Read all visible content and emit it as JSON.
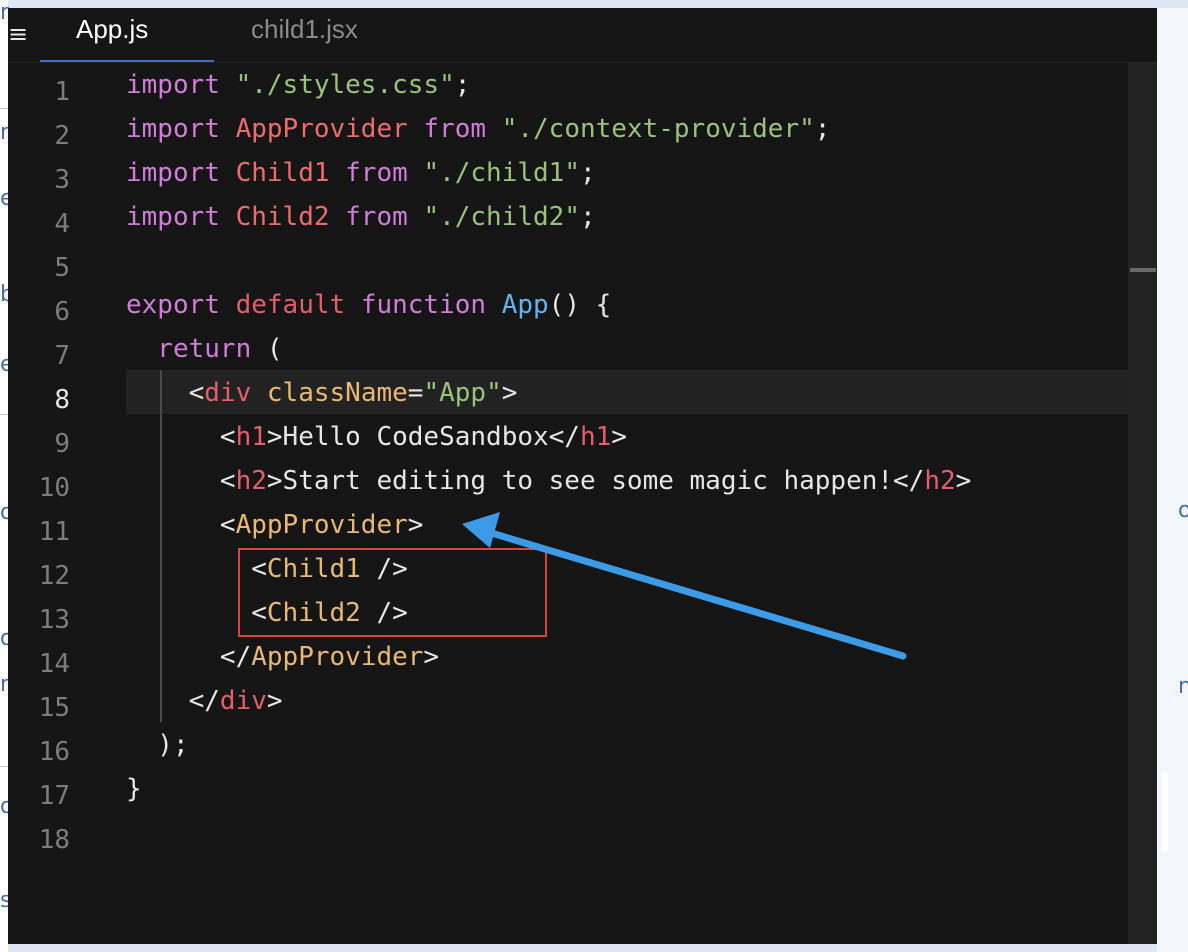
{
  "editor": {
    "menu_icon": "≡",
    "tabs": [
      {
        "label": "App.js",
        "active": true
      },
      {
        "label": "child1.jsx",
        "active": false
      }
    ],
    "active_line": 8,
    "line_numbers": [
      "1",
      "2",
      "3",
      "4",
      "5",
      "6",
      "7",
      "8",
      "9",
      "10",
      "11",
      "12",
      "13",
      "14",
      "15",
      "16",
      "17",
      "18"
    ]
  },
  "code_lines": [
    [
      {
        "t": "import ",
        "c": "kw"
      },
      {
        "t": "\"./styles.css\"",
        "c": "str"
      },
      {
        "t": ";",
        "c": "punc"
      }
    ],
    [
      {
        "t": "import ",
        "c": "kw"
      },
      {
        "t": "AppProvider ",
        "c": "cls"
      },
      {
        "t": "from ",
        "c": "kw"
      },
      {
        "t": "\"./context-provider\"",
        "c": "str"
      },
      {
        "t": ";",
        "c": "punc"
      }
    ],
    [
      {
        "t": "import ",
        "c": "kw"
      },
      {
        "t": "Child1 ",
        "c": "cls"
      },
      {
        "t": "from ",
        "c": "kw"
      },
      {
        "t": "\"./child1\"",
        "c": "str"
      },
      {
        "t": ";",
        "c": "punc"
      }
    ],
    [
      {
        "t": "import ",
        "c": "kw"
      },
      {
        "t": "Child2 ",
        "c": "cls"
      },
      {
        "t": "from ",
        "c": "kw"
      },
      {
        "t": "\"./child2\"",
        "c": "str"
      },
      {
        "t": ";",
        "c": "punc"
      }
    ],
    [],
    [
      {
        "t": "export ",
        "c": "kw"
      },
      {
        "t": "default ",
        "c": "tag"
      },
      {
        "t": "function ",
        "c": "kw"
      },
      {
        "t": "App",
        "c": "fn"
      },
      {
        "t": "() {",
        "c": "punc"
      }
    ],
    [
      {
        "t": "  return ",
        "c": "kw"
      },
      {
        "t": "(",
        "c": "punc"
      }
    ],
    [
      {
        "t": "    <",
        "c": "punc"
      },
      {
        "t": "div ",
        "c": "tag"
      },
      {
        "t": "className",
        "c": "attr"
      },
      {
        "t": "=",
        "c": "punc"
      },
      {
        "t": "\"App\"",
        "c": "str"
      },
      {
        "t": ">",
        "c": "punc"
      }
    ],
    [
      {
        "t": "      <",
        "c": "punc"
      },
      {
        "t": "h1",
        "c": "tag"
      },
      {
        "t": ">Hello CodeSandbox</",
        "c": "punc"
      },
      {
        "t": "h1",
        "c": "tag"
      },
      {
        "t": ">",
        "c": "punc"
      }
    ],
    [
      {
        "t": "      <",
        "c": "punc"
      },
      {
        "t": "h2",
        "c": "tag"
      },
      {
        "t": ">Start editing to see some magic happen!</",
        "c": "punc"
      },
      {
        "t": "h2",
        "c": "tag"
      },
      {
        "t": ">",
        "c": "punc"
      }
    ],
    [
      {
        "t": "      <",
        "c": "punc"
      },
      {
        "t": "AppProvider",
        "c": "comp"
      },
      {
        "t": ">",
        "c": "punc"
      }
    ],
    [
      {
        "t": "        <",
        "c": "punc"
      },
      {
        "t": "Child1 ",
        "c": "comp"
      },
      {
        "t": "/>",
        "c": "punc"
      }
    ],
    [
      {
        "t": "        <",
        "c": "punc"
      },
      {
        "t": "Child2 ",
        "c": "comp"
      },
      {
        "t": "/>",
        "c": "punc"
      }
    ],
    [
      {
        "t": "      </",
        "c": "punc"
      },
      {
        "t": "AppProvider",
        "c": "comp"
      },
      {
        "t": ">",
        "c": "punc"
      }
    ],
    [
      {
        "t": "    </",
        "c": "punc"
      },
      {
        "t": "div",
        "c": "tag"
      },
      {
        "t": ">",
        "c": "punc"
      }
    ],
    [
      {
        "t": "  );",
        "c": "punc"
      }
    ],
    [
      {
        "t": "}",
        "c": "punc"
      }
    ],
    []
  ],
  "annotations": {
    "box_color": "#d9443a",
    "arrow_color": "#3b9be6"
  },
  "colors": {
    "editor_bg": "#151515",
    "keyword": "#d17cd9",
    "string": "#99c27a",
    "identifier": "#ee6b6b",
    "function": "#5fb5f0",
    "jsx_tag": "#e55d6b",
    "component": "#e9b872"
  }
}
